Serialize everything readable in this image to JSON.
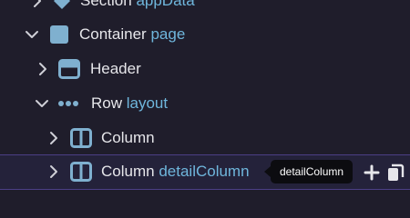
{
  "tree": {
    "nodes": [
      {
        "name": "Section",
        "sub": "appData",
        "icon": "diamond-icon",
        "expanded": false
      },
      {
        "name": "Container",
        "sub": "page",
        "icon": "square-icon",
        "expanded": true
      },
      {
        "name": "Header",
        "sub": "",
        "icon": "header-icon",
        "expanded": false
      },
      {
        "name": "Row",
        "sub": "layout",
        "icon": "dots-icon",
        "expanded": true
      },
      {
        "name": "Column",
        "sub": "",
        "icon": "column-icon",
        "expanded": false
      },
      {
        "name": "Column",
        "sub": "detailColumn",
        "icon": "column-icon",
        "expanded": false,
        "selected": true
      }
    ]
  },
  "tooltip": {
    "text": "detailColumn"
  },
  "actions": {
    "add_icon": "plus-icon",
    "copy_icon": "copy-icon"
  },
  "colors": {
    "background": "#1f1d2b",
    "selected_row": "#24223a",
    "selected_border": "#4b3f86",
    "accent_sub": "#6fb6dc",
    "icon": "#7fb0cf",
    "text": "#e6e6ea"
  }
}
